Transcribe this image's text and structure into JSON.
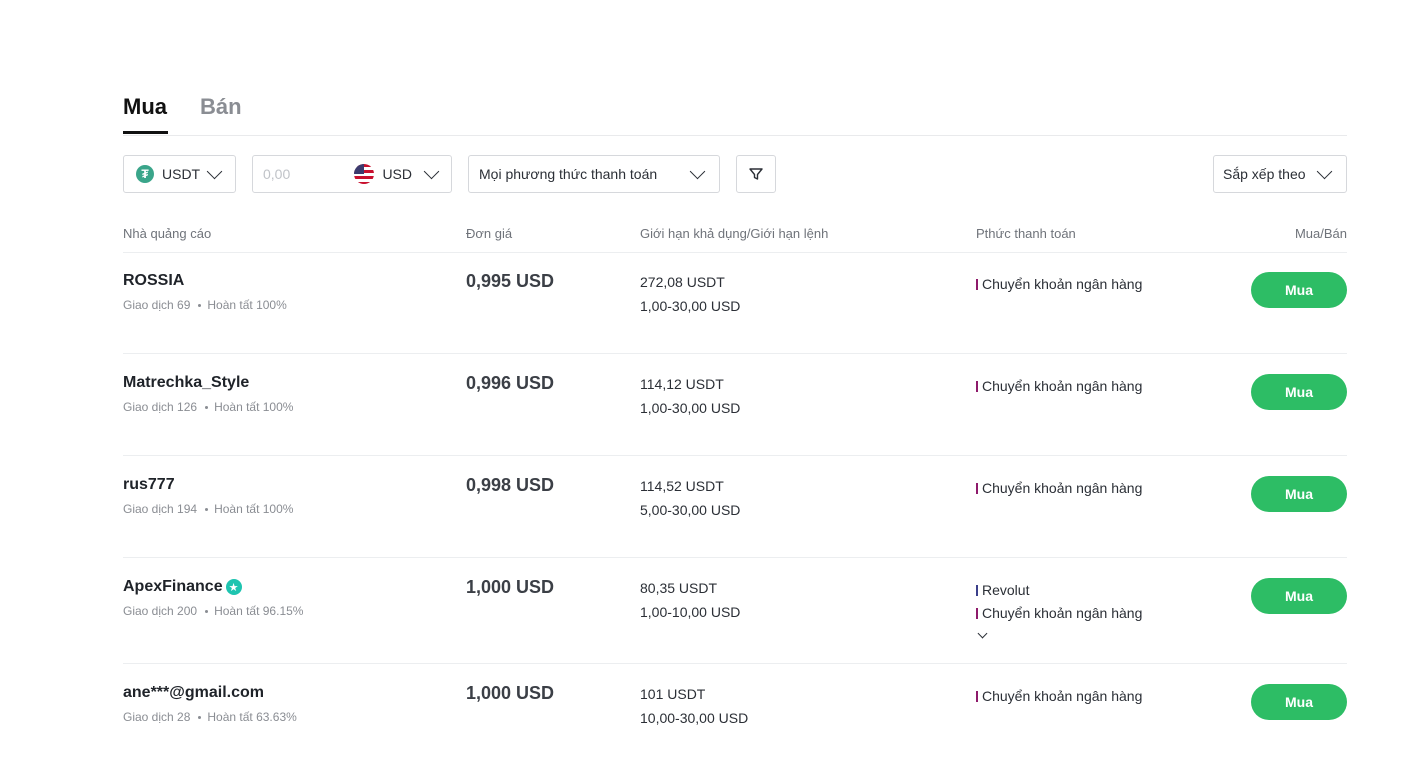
{
  "tabs": {
    "buy": "Mua",
    "sell": "Bán"
  },
  "filters": {
    "crypto": "USDT",
    "amount_placeholder": "0,00",
    "fiat": "USD",
    "payment_method": "Mọi phương thức thanh toán",
    "sort": "Sắp xếp theo"
  },
  "table": {
    "headers": {
      "advertiser": "Nhà quảng cáo",
      "price": "Đơn giá",
      "limits": "Giới hạn khả dụng/Giới hạn lệnh",
      "payment": "Pthức thanh toán",
      "action": "Mua/Bán"
    },
    "rows": [
      {
        "name": "ROSSIA",
        "trades": "Giao dịch 69",
        "completion": "Hoàn tất 100%",
        "price": "0,995 USD",
        "available": "272,08 USDT",
        "limit": "1,00-30,00 USD",
        "payments": [
          "Chuyển khoản ngân hàng"
        ],
        "button": "Mua"
      },
      {
        "name": "Matrechka_Style",
        "trades": "Giao dịch 126",
        "completion": "Hoàn tất 100%",
        "price": "0,996 USD",
        "available": "114,12 USDT",
        "limit": "1,00-30,00 USD",
        "payments": [
          "Chuyển khoản ngân hàng"
        ],
        "button": "Mua"
      },
      {
        "name": "rus777",
        "trades": "Giao dịch 194",
        "completion": "Hoàn tất 100%",
        "price": "0,998 USD",
        "available": "114,52 USDT",
        "limit": "5,00-30,00 USD",
        "payments": [
          "Chuyển khoản ngân hàng"
        ],
        "button": "Mua"
      },
      {
        "name": "ApexFinance",
        "trades": "Giao dịch 200",
        "completion": "Hoàn tất 96.15%",
        "price": "1,000 USD",
        "available": "80,35 USDT",
        "limit": "1,00-10,00 USD",
        "payments": [
          "Revolut",
          "Chuyển khoản ngân hàng"
        ],
        "button": "Mua"
      },
      {
        "name": "ane***@gmail.com",
        "trades": "Giao dịch 28",
        "completion": "Hoàn tất 63.63%",
        "price": "1,000 USD",
        "available": "101 USDT",
        "limit": "10,00-30,00 USD",
        "payments": [
          "Chuyển khoản ngân hàng"
        ],
        "button": "Mua"
      }
    ]
  },
  "colors": {
    "buy_button": "#2dbd65",
    "bank_transfer_marker": "#8e1a6b",
    "revolut_marker": "#3b3f8a",
    "verified_badge": "#1ec4b0"
  },
  "icons": {
    "tether": "tether-icon",
    "flag": "us-flag-icon",
    "filter": "filter-icon",
    "chevron": "chevron-down-icon",
    "verified": "verified-badge-icon"
  }
}
